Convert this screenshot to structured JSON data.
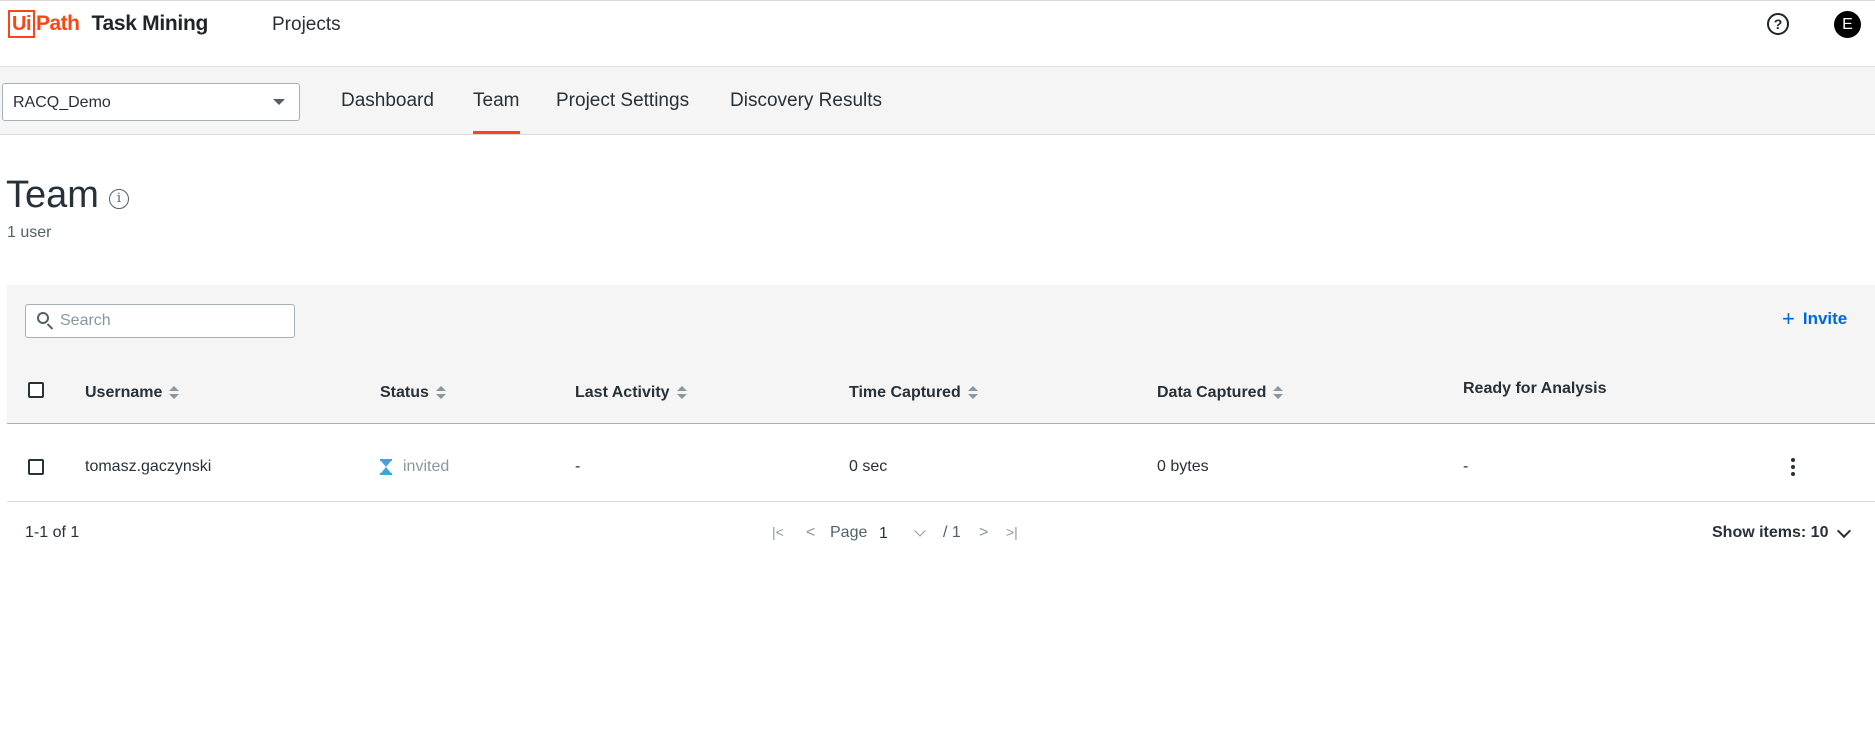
{
  "app": {
    "logo_ui": "Ui",
    "logo_path": "Path",
    "product": "Task Mining",
    "nav_projects": "Projects",
    "help_symbol": "?",
    "avatar_initial": "E"
  },
  "subnav": {
    "project_selected": "RACQ_Demo",
    "tabs": [
      {
        "label": "Dashboard"
      },
      {
        "label": "Team"
      },
      {
        "label": "Project Settings"
      },
      {
        "label": "Discovery Results"
      }
    ],
    "active_tab": "Team"
  },
  "page": {
    "title": "Team",
    "info_symbol": "i",
    "user_count": "1 user"
  },
  "toolbar": {
    "search_placeholder": "Search",
    "invite_label": "Invite",
    "plus_symbol": "+"
  },
  "table": {
    "columns": [
      {
        "label": "Username"
      },
      {
        "label": "Status"
      },
      {
        "label": "Last Activity"
      },
      {
        "label": "Time Captured"
      },
      {
        "label": "Data Captured"
      },
      {
        "label": "Ready for Analysis"
      }
    ],
    "rows": [
      {
        "username": "tomasz.gaczynski",
        "status": "invited",
        "last_activity": "-",
        "time_captured": "0 sec",
        "data_captured": "0 bytes",
        "ready_for_analysis": "-"
      }
    ]
  },
  "pagination": {
    "range": "1-1 of 1",
    "first": "|<",
    "prev": "<",
    "page_label": "Page",
    "page_value": "1",
    "total": "/ 1",
    "next": ">",
    "last": ">|",
    "show_items": "Show items: 10"
  },
  "colors": {
    "brand": "#fa4616",
    "link": "#0067df",
    "status_invited": "#3ba6dd"
  }
}
